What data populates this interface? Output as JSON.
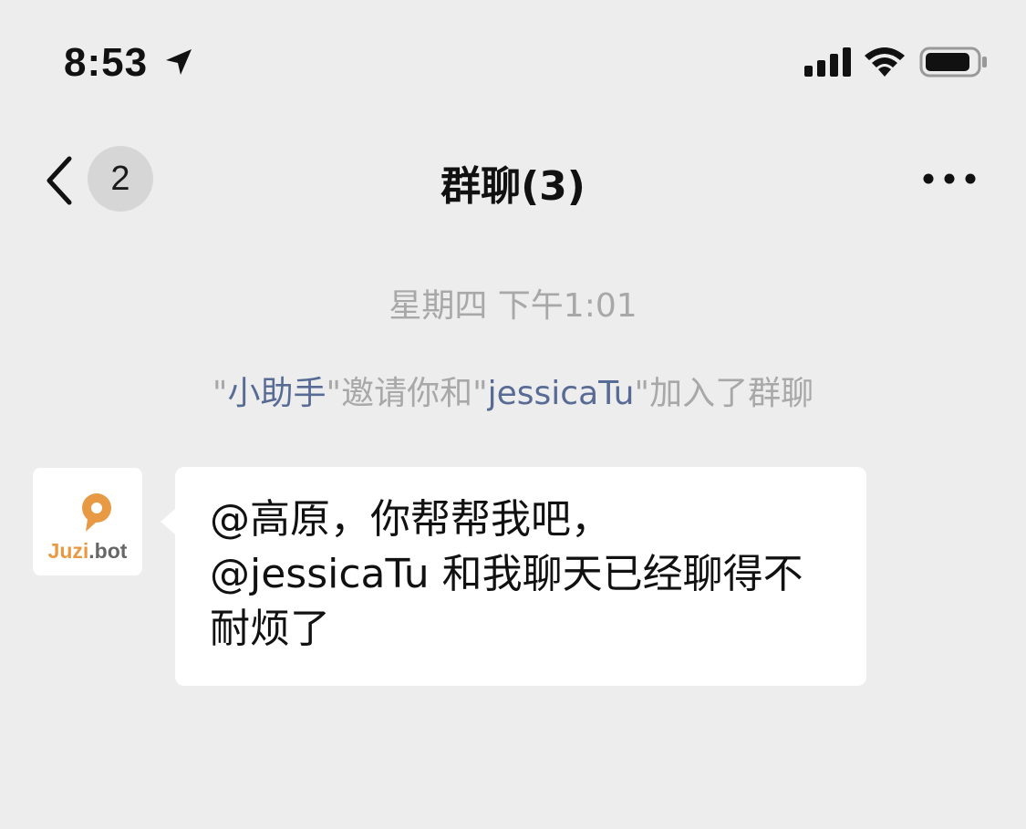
{
  "status_bar": {
    "time": "8:53",
    "icons": [
      "location-arrow-icon",
      "cellular-signal-icon",
      "wifi-icon",
      "battery-icon"
    ]
  },
  "nav_bar": {
    "back_icon": "chevron-left-icon",
    "unread_count": "2",
    "title": "群聊(3)",
    "more_icon": "ellipsis-icon"
  },
  "chat": {
    "timestamp": "星期四 下午1:01",
    "system_notice": {
      "q1_open": "\"",
      "inviter": "小助手",
      "q1_close": "\"",
      "text_mid": "邀请你和",
      "q2_open": "\"",
      "invitee": "jessicaTu",
      "q2_close": "\"",
      "text_end": "加入了群聊"
    },
    "messages": [
      {
        "sender_avatar": {
          "brand_part1": "Juzi",
          "brand_part2": ".bot",
          "logo_color": "#e89944"
        },
        "lines": [
          "@高原，你帮帮我吧，",
          "@jessicaTu 和我聊天已经聊得不",
          "耐烦了"
        ]
      }
    ]
  },
  "colors": {
    "background": "#ededed",
    "bubble": "#ffffff",
    "mention_link": "#576b95",
    "muted_text": "#a8a8a8"
  }
}
